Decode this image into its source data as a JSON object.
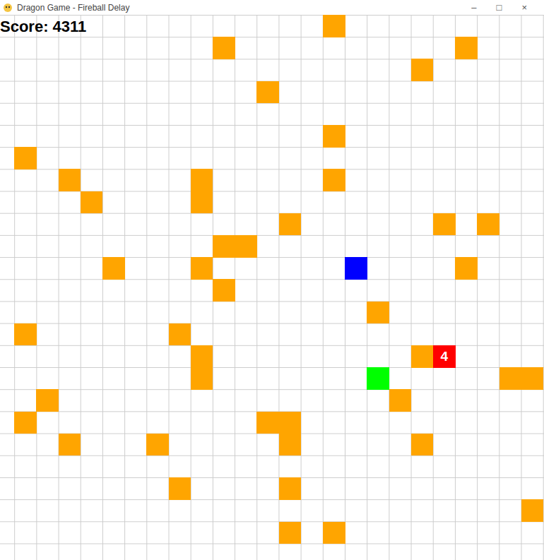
{
  "window": {
    "title": "Dragon Game - Fireball Delay",
    "controls": [
      "–",
      "□",
      "×"
    ]
  },
  "score": "Score: 4311",
  "grid": {
    "columns": 25,
    "rows": 25
  },
  "cells": [
    {
      "kind": "obstacle",
      "col": 15,
      "row": 0,
      "color": "#ffa500"
    },
    {
      "kind": "obstacle",
      "col": 10,
      "row": 1,
      "color": "#ffa500"
    },
    {
      "kind": "obstacle",
      "col": 21,
      "row": 1,
      "color": "#ffa500"
    },
    {
      "kind": "obstacle",
      "col": 19,
      "row": 2,
      "color": "#ffa500"
    },
    {
      "kind": "obstacle",
      "col": 12,
      "row": 3,
      "color": "#ffa500"
    },
    {
      "kind": "obstacle",
      "col": 15,
      "row": 5,
      "color": "#ffa500"
    },
    {
      "kind": "obstacle",
      "col": 1,
      "row": 6,
      "color": "#ffa500"
    },
    {
      "kind": "obstacle",
      "col": 3,
      "row": 7,
      "color": "#ffa500"
    },
    {
      "kind": "obstacle",
      "col": 9,
      "row": 7,
      "color": "#ffa500"
    },
    {
      "kind": "obstacle",
      "col": 15,
      "row": 7,
      "color": "#ffa500"
    },
    {
      "kind": "obstacle",
      "col": 4,
      "row": 8,
      "color": "#ffa500"
    },
    {
      "kind": "obstacle",
      "col": 9,
      "row": 8,
      "color": "#ffa500"
    },
    {
      "kind": "obstacle",
      "col": 13,
      "row": 9,
      "color": "#ffa500"
    },
    {
      "kind": "obstacle",
      "col": 20,
      "row": 9,
      "color": "#ffa500"
    },
    {
      "kind": "obstacle",
      "col": 22,
      "row": 9,
      "color": "#ffa500"
    },
    {
      "kind": "obstacle",
      "col": 10,
      "row": 10,
      "color": "#ffa500"
    },
    {
      "kind": "obstacle",
      "col": 11,
      "row": 10,
      "color": "#ffa500"
    },
    {
      "kind": "obstacle",
      "col": 5,
      "row": 11,
      "color": "#ffa500"
    },
    {
      "kind": "obstacle",
      "col": 9,
      "row": 11,
      "color": "#ffa500"
    },
    {
      "kind": "player",
      "col": 16,
      "row": 11,
      "color": "#0000ff"
    },
    {
      "kind": "obstacle",
      "col": 21,
      "row": 11,
      "color": "#ffa500"
    },
    {
      "kind": "obstacle",
      "col": 10,
      "row": 12,
      "color": "#ffa500"
    },
    {
      "kind": "obstacle",
      "col": 17,
      "row": 13,
      "color": "#ffa500"
    },
    {
      "kind": "obstacle",
      "col": 1,
      "row": 14,
      "color": "#ffa500"
    },
    {
      "kind": "obstacle",
      "col": 8,
      "row": 14,
      "color": "#ffa500"
    },
    {
      "kind": "obstacle",
      "col": 9,
      "row": 15,
      "color": "#ffa500"
    },
    {
      "kind": "obstacle",
      "col": 19,
      "row": 15,
      "color": "#ffa500"
    },
    {
      "kind": "dragon",
      "col": 20,
      "row": 15,
      "color": "#ff0000",
      "label": "4"
    },
    {
      "kind": "obstacle",
      "col": 9,
      "row": 16,
      "color": "#ffa500"
    },
    {
      "kind": "target",
      "col": 17,
      "row": 16,
      "color": "#00ff00"
    },
    {
      "kind": "obstacle",
      "col": 23,
      "row": 16,
      "color": "#ffa500"
    },
    {
      "kind": "obstacle",
      "col": 24,
      "row": 16,
      "color": "#ffa500"
    },
    {
      "kind": "obstacle",
      "col": 2,
      "row": 17,
      "color": "#ffa500"
    },
    {
      "kind": "obstacle",
      "col": 18,
      "row": 17,
      "color": "#ffa500"
    },
    {
      "kind": "obstacle",
      "col": 1,
      "row": 18,
      "color": "#ffa500"
    },
    {
      "kind": "obstacle",
      "col": 12,
      "row": 18,
      "color": "#ffa500"
    },
    {
      "kind": "obstacle",
      "col": 13,
      "row": 18,
      "color": "#ffa500"
    },
    {
      "kind": "obstacle",
      "col": 3,
      "row": 19,
      "color": "#ffa500"
    },
    {
      "kind": "obstacle",
      "col": 7,
      "row": 19,
      "color": "#ffa500"
    },
    {
      "kind": "obstacle",
      "col": 13,
      "row": 19,
      "color": "#ffa500"
    },
    {
      "kind": "obstacle",
      "col": 19,
      "row": 19,
      "color": "#ffa500"
    },
    {
      "kind": "obstacle",
      "col": 8,
      "row": 21,
      "color": "#ffa500"
    },
    {
      "kind": "obstacle",
      "col": 13,
      "row": 21,
      "color": "#ffa500"
    },
    {
      "kind": "obstacle",
      "col": 24,
      "row": 22,
      "color": "#ffa500"
    },
    {
      "kind": "obstacle",
      "col": 13,
      "row": 23,
      "color": "#ffa500"
    },
    {
      "kind": "obstacle",
      "col": 15,
      "row": 23,
      "color": "#ffa500"
    }
  ]
}
